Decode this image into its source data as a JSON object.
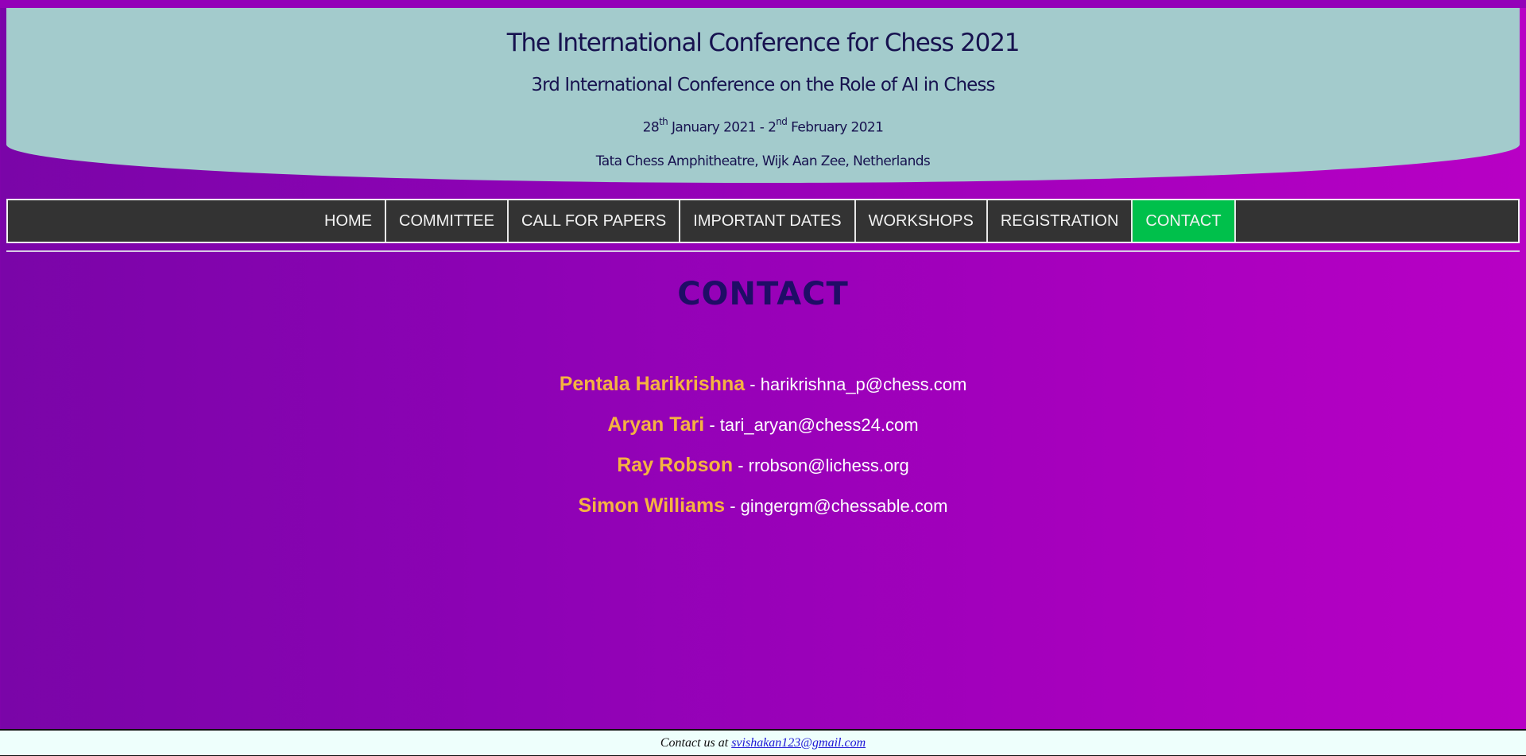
{
  "header": {
    "title": "The International Conference for Chess 2021",
    "subtitle": "3rd International Conference on the Role of AI in Chess",
    "dates": {
      "start_day": "28",
      "start_suffix": "th",
      "start_rest": "January 2021 - 2",
      "end_suffix": "nd",
      "end_rest": "February 2021"
    },
    "venue": "Tata Chess Amphitheatre, Wijk Aan Zee, Netherlands"
  },
  "nav": {
    "items": [
      {
        "label": "HOME"
      },
      {
        "label": "COMMITTEE"
      },
      {
        "label": "CALL FOR PAPERS"
      },
      {
        "label": "IMPORTANT DATES"
      },
      {
        "label": "WORKSHOPS"
      },
      {
        "label": "REGISTRATION"
      },
      {
        "label": "CONTACT"
      }
    ],
    "active": "CONTACT",
    "active_color": "#00c04b"
  },
  "main": {
    "heading": "CONTACT",
    "separator": " - ",
    "contacts": [
      {
        "name": "Pentala Harikrishna",
        "email": "harikrishna_p@chess.com"
      },
      {
        "name": "Aryan Tari",
        "email": "tari_aryan@chess24.com"
      },
      {
        "name": "Ray Robson",
        "email": "rrobson@lichess.org"
      },
      {
        "name": "Simon Williams",
        "email": "gingergm@chessable.com"
      }
    ]
  },
  "footer": {
    "text": "Contact us at ",
    "email": "svishakan123@gmail.com"
  },
  "colors": {
    "header_bg": "#a3cbcc",
    "nav_bg": "#333333",
    "name_color": "#f5b340",
    "heading_color": "#1f0d66"
  }
}
